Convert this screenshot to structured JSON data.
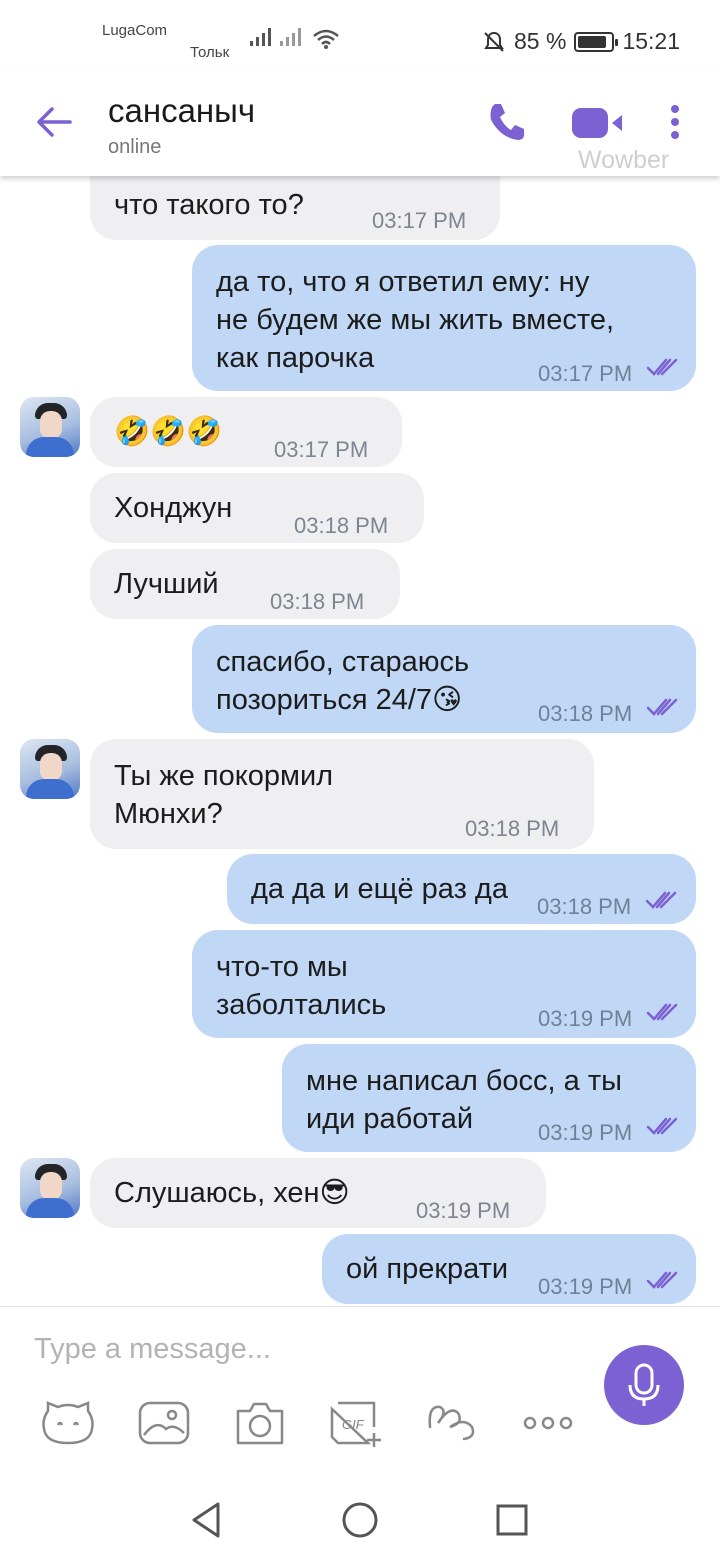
{
  "status_bar": {
    "carrier": "LugaCom",
    "carrier_sub": "Тольк",
    "battery": "85 %",
    "time": "15:21"
  },
  "header": {
    "name": "сансаныч",
    "status": "online",
    "watermark": "Wowber"
  },
  "messages": [
    {
      "dir": "in",
      "text": "что такого то?",
      "time": "03:17 PM"
    },
    {
      "dir": "out",
      "text": "да то, что я ответил ему: ну\nне будем же мы жить вместе,\nкак парочка",
      "time": "03:17 PM"
    },
    {
      "dir": "in",
      "text": "🤣🤣🤣",
      "time": "03:17 PM"
    },
    {
      "dir": "in",
      "text": "Хонджун",
      "time": "03:18 PM"
    },
    {
      "dir": "in",
      "text": "Лучший",
      "time": "03:18 PM"
    },
    {
      "dir": "out",
      "text": "спасибо, стараюсь\nпозориться 24/7😘",
      "time": "03:18 PM"
    },
    {
      "dir": "in",
      "text": "Ты же покормил\nМюнхи?",
      "time": "03:18 PM"
    },
    {
      "dir": "out",
      "text": "да да и ещё раз да",
      "time": "03:18 PM"
    },
    {
      "dir": "out",
      "text": "что-то мы\nзаболтались",
      "time": "03:19 PM"
    },
    {
      "dir": "out",
      "text": "мне написал босс, а ты\nиди работай",
      "time": "03:19 PM"
    },
    {
      "dir": "in",
      "text": "Слушаюсь, хен😎",
      "time": "03:19 PM"
    },
    {
      "dir": "out",
      "text": "ой прекрати",
      "time": "03:19 PM"
    }
  ],
  "input": {
    "placeholder": "Type a message..."
  },
  "toolbar_icons": [
    "sticker-icon",
    "gallery-icon",
    "camera-icon",
    "gif-icon",
    "doodle-icon",
    "more-options-icon"
  ],
  "colors": {
    "accent": "#7b61d1",
    "outgoing_bubble": "#c0d8f6",
    "incoming_bubble": "#efeff1",
    "read_ticks": "#7b61d1"
  }
}
